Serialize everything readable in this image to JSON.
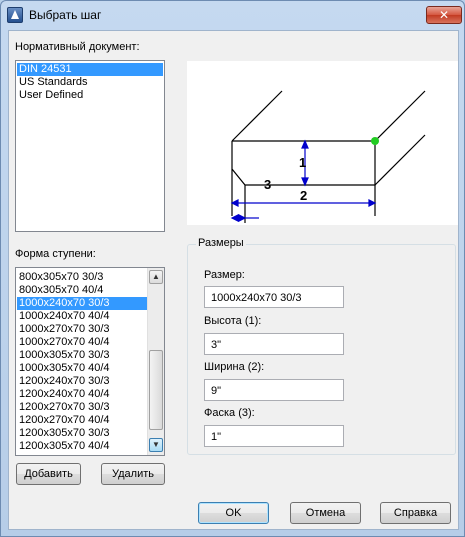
{
  "window": {
    "title": "Выбрать шаг",
    "close_glyph": "✕"
  },
  "standard": {
    "label": "Нормативный документ:",
    "items": [
      "DIN 24531",
      "US Standards",
      "User Defined"
    ],
    "selected_index": 0
  },
  "steps": {
    "label": "Форма ступени:",
    "items": [
      "800x305x70 30/3",
      "800x305x70 40/4",
      "1000x240x70 30/3",
      "1000x240x70 40/4",
      "1000x270x70 30/3",
      "1000x270x70 40/4",
      "1000x305x70 30/3",
      "1000x305x70 40/4",
      "1200x240x70 30/3",
      "1200x240x70 40/4",
      "1200x270x70 30/3",
      "1200x270x70 40/4",
      "1200x305x70 30/3",
      "1200x305x70 40/4"
    ],
    "selected_index": 2
  },
  "preview": {
    "dim1": "1",
    "dim2": "2",
    "dim3": "3"
  },
  "sizes": {
    "group_title": "Размеры",
    "size_label": "Размер:",
    "size_value": "1000x240x70 30/3",
    "height_label": "Высота (1):",
    "height_value": "3\"",
    "width_label": "Ширина (2):",
    "width_value": "9\"",
    "chamfer_label": "Фаска (3):",
    "chamfer_value": "1\""
  },
  "buttons": {
    "add": "Добавить",
    "delete": "Удалить",
    "ok": "OK",
    "cancel": "Отмена",
    "help": "Справка"
  },
  "icons": {
    "app": "autocad-app-icon",
    "close": "close-icon",
    "scroll_up": "arrow-up-icon",
    "scroll_down": "arrow-down-icon"
  },
  "colors": {
    "selection": "#3399ff",
    "dimension": "#0000cc",
    "grip": "#22cc22",
    "close": "#c94a33"
  }
}
